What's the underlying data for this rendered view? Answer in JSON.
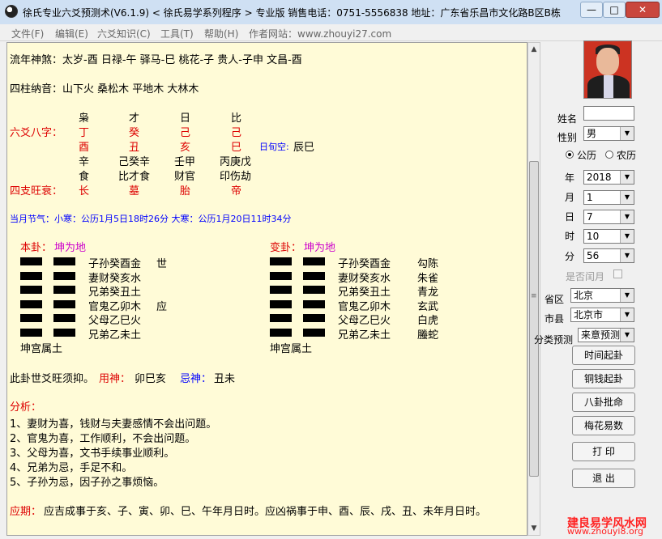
{
  "window": {
    "title": "徐氏专业六爻预测术(V6.1.9)   < 徐氏易学系列程序 > 专业版  销售电话：0751-5556838  地址：广东省乐昌市文化路B区B栋",
    "min_label": "—",
    "max_label": "□",
    "close_label": "✕"
  },
  "menu": [
    "文件(F)",
    "编辑(E)",
    "六爻知识(C)",
    "工具(T)",
    "帮助(H)",
    "作者网站：www.zhouyi27.com"
  ],
  "content": {
    "shensha": "流年神煞：太岁-酉  日禄-午  驿马-巳  桃花-子  贵人-子申  文昌-酉",
    "nayin": "四柱纳音：山下火     桑松木     平地木     大林木",
    "bazi_label": "六爻八字：",
    "shishen_row": [
      "枭",
      "才",
      "日",
      "比"
    ],
    "stem_row": [
      "丁",
      "癸",
      "己",
      "己"
    ],
    "branch_row": [
      "酉",
      "丑",
      "亥",
      "巳"
    ],
    "xunkong": "日旬空:",
    "xunkong_value": "辰巳",
    "canggan_row": [
      "辛",
      "己癸辛",
      "壬甲",
      "丙庚戊"
    ],
    "canggan_shishen_row": [
      "食",
      "比才食",
      "财官",
      "印伤劫"
    ],
    "wangshuai_label": "四支旺衰：",
    "wangshuai_row": [
      "长",
      "墓",
      "胎",
      "帝"
    ],
    "jieqi": "当月节气：小寒：公历1月5日18时26分  大寒：公历1月20日11时34分",
    "ben_gua_label": "本卦：",
    "ben_gua_name": "坤为地",
    "bian_gua_label": "变卦：",
    "bian_gua_name": "坤为地",
    "ben_lines": [
      "子孙癸酉金",
      "妻财癸亥水",
      "兄弟癸丑土",
      "官鬼乙卯木",
      "父母乙巳火",
      "兄弟乙未土"
    ],
    "ben_marks": [
      "世",
      "",
      "",
      "应",
      "",
      ""
    ],
    "bian_lines": [
      "子孙癸酉金",
      "妻财癸亥水",
      "兄弟癸丑土",
      "官鬼乙卯木",
      "父母乙巳火",
      "兄弟乙未土"
    ],
    "six_gods": [
      "勾陈",
      "朱雀",
      "青龙",
      "玄武",
      "白虎",
      "螣蛇"
    ],
    "ben_palace": "坤宫属土",
    "bian_palace": "坤宫属土",
    "shi_yao": "此卦世爻旺须抑。",
    "yongshen_label": "用神：",
    "yongshen_value": "卯巳亥",
    "jishen_label": "忌神：",
    "jishen_value": "丑未",
    "analysis_label": "分析：",
    "analysis": [
      "1、妻财为喜，钱财与夫妻感情不会出问题。",
      "2、官鬼为喜，工作顺利，不会出问题。",
      "3、父母为喜，文书手续事业顺利。",
      "4、兄弟为忌，手足不和。",
      "5、子孙为忌，因子孙之事烦恼。"
    ],
    "yingqi_label": "应期：",
    "yingqi_value": "应吉成事于亥、子、寅、卯、巳、午年月日时。应凶祸事于申、酉、辰、戌、丑、未年月日时。"
  },
  "sidebar": {
    "name_label": "姓名",
    "name_value": "",
    "gender_label": "性别",
    "gender_value": "男",
    "calendar_solar": "公历",
    "calendar_lunar": "农历",
    "year_label": "年",
    "year_value": "2018",
    "month_label": "月",
    "month_value": "1",
    "day_label": "日",
    "day_value": "7",
    "hour_label": "时",
    "hour_value": "10",
    "minute_label": "分",
    "minute_value": "56",
    "leap_label": "是否闰月",
    "province_label": "省区",
    "province_value": "北京",
    "city_label": "市县",
    "city_value": "北京市",
    "category_label": "分类预测",
    "category_value": "来意预测",
    "buttons": [
      "时间起卦",
      "铜钱起卦",
      "八卦批命",
      "梅花易数",
      "打 印",
      "退 出"
    ]
  },
  "watermark": {
    "line1": "建良易学风水网",
    "line2": "www.zhouyi8.org"
  }
}
